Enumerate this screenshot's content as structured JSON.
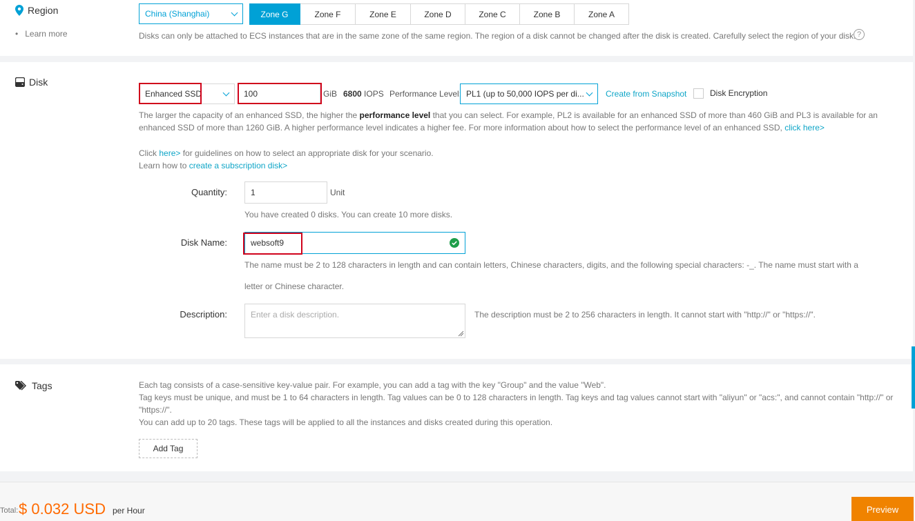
{
  "region": {
    "title": "Region",
    "learn_more": "Learn more",
    "region_select": "China (Shanghai)",
    "zones": [
      "Zone G",
      "Zone F",
      "Zone E",
      "Zone D",
      "Zone C",
      "Zone B",
      "Zone A"
    ],
    "active_zone": "Zone G",
    "note": "Disks can only be attached to ECS instances that are in the same zone of the same region. The region of a disk cannot be changed after the disk is created. Carefully select the region of your disk."
  },
  "disk": {
    "title": "Disk",
    "type": "Enhanced SSD",
    "size": "100",
    "unit": "GiB",
    "iops_value": "6800",
    "iops_label": "IOPS",
    "perf_label": "Performance Level:",
    "perf_value": "PL1 (up to 50,000 IOPS per di...",
    "snapshot_link": "Create from Snapshot",
    "encryption_label": "Disk Encryption",
    "desc1_a": "The larger the capacity of an enhanced SSD, the higher the ",
    "desc1_bold": "performance level",
    "desc1_b": " that you can select. For example, PL2 is available for an enhanced SSD of more than 460 GiB and PL3 is available for an",
    "desc2_a": "enhanced SSD of more than 1260 GiB. A higher performance level indicates a higher fee. For more information about how to select the performance level of an enhanced SSD, ",
    "desc2_link": "click here>",
    "click_prefix": "Click ",
    "click_link": "here>",
    "click_suffix": " for guidelines on how to select an appropriate disk for your scenario.",
    "learn_prefix": "Learn how to ",
    "learn_link": "create a subscription disk>",
    "quantity_label": "Quantity:",
    "quantity_value": "1",
    "quantity_unit": "Unit",
    "quantity_note": "You have created 0 disks. You can create 10 more disks.",
    "name_label": "Disk Name:",
    "name_value": "websoft9",
    "name_note1": "The name must be 2 to 128 characters in length and can contain letters, Chinese characters, digits, and the following special characters: -_. The name must start with a",
    "name_note2": "letter or Chinese character.",
    "description_label": "Description:",
    "description_placeholder": "Enter a disk description.",
    "description_note": "The description must be 2 to 256 characters in length. It cannot start with \"http://\" or \"https://\"."
  },
  "tags": {
    "title": "Tags",
    "line1": "Each tag consists of a case-sensitive key-value pair. For example, you can add a tag with the key \"Group\" and the value \"Web\".",
    "line2": "Tag keys must be unique, and must be 1 to 64 characters in length. Tag values can be 0 to 128 characters in length. Tag keys and tag values cannot start with \"aliyun\" or \"acs:\", and cannot contain \"http://\" or",
    "line3": "\"https://\".",
    "line4": "You can add up to 20 tags. These tags will be applied to all the instances and disks created during this operation.",
    "add_tag": "Add Tag"
  },
  "footer": {
    "total_label": "Total:",
    "price": "$ 0.032 USD",
    "per": "per Hour",
    "preview": "Preview"
  },
  "colors": {
    "accent": "#00a1d6",
    "orange": "#ff6a00",
    "preview_bg": "#f08300",
    "highlight": "#d0021b"
  }
}
